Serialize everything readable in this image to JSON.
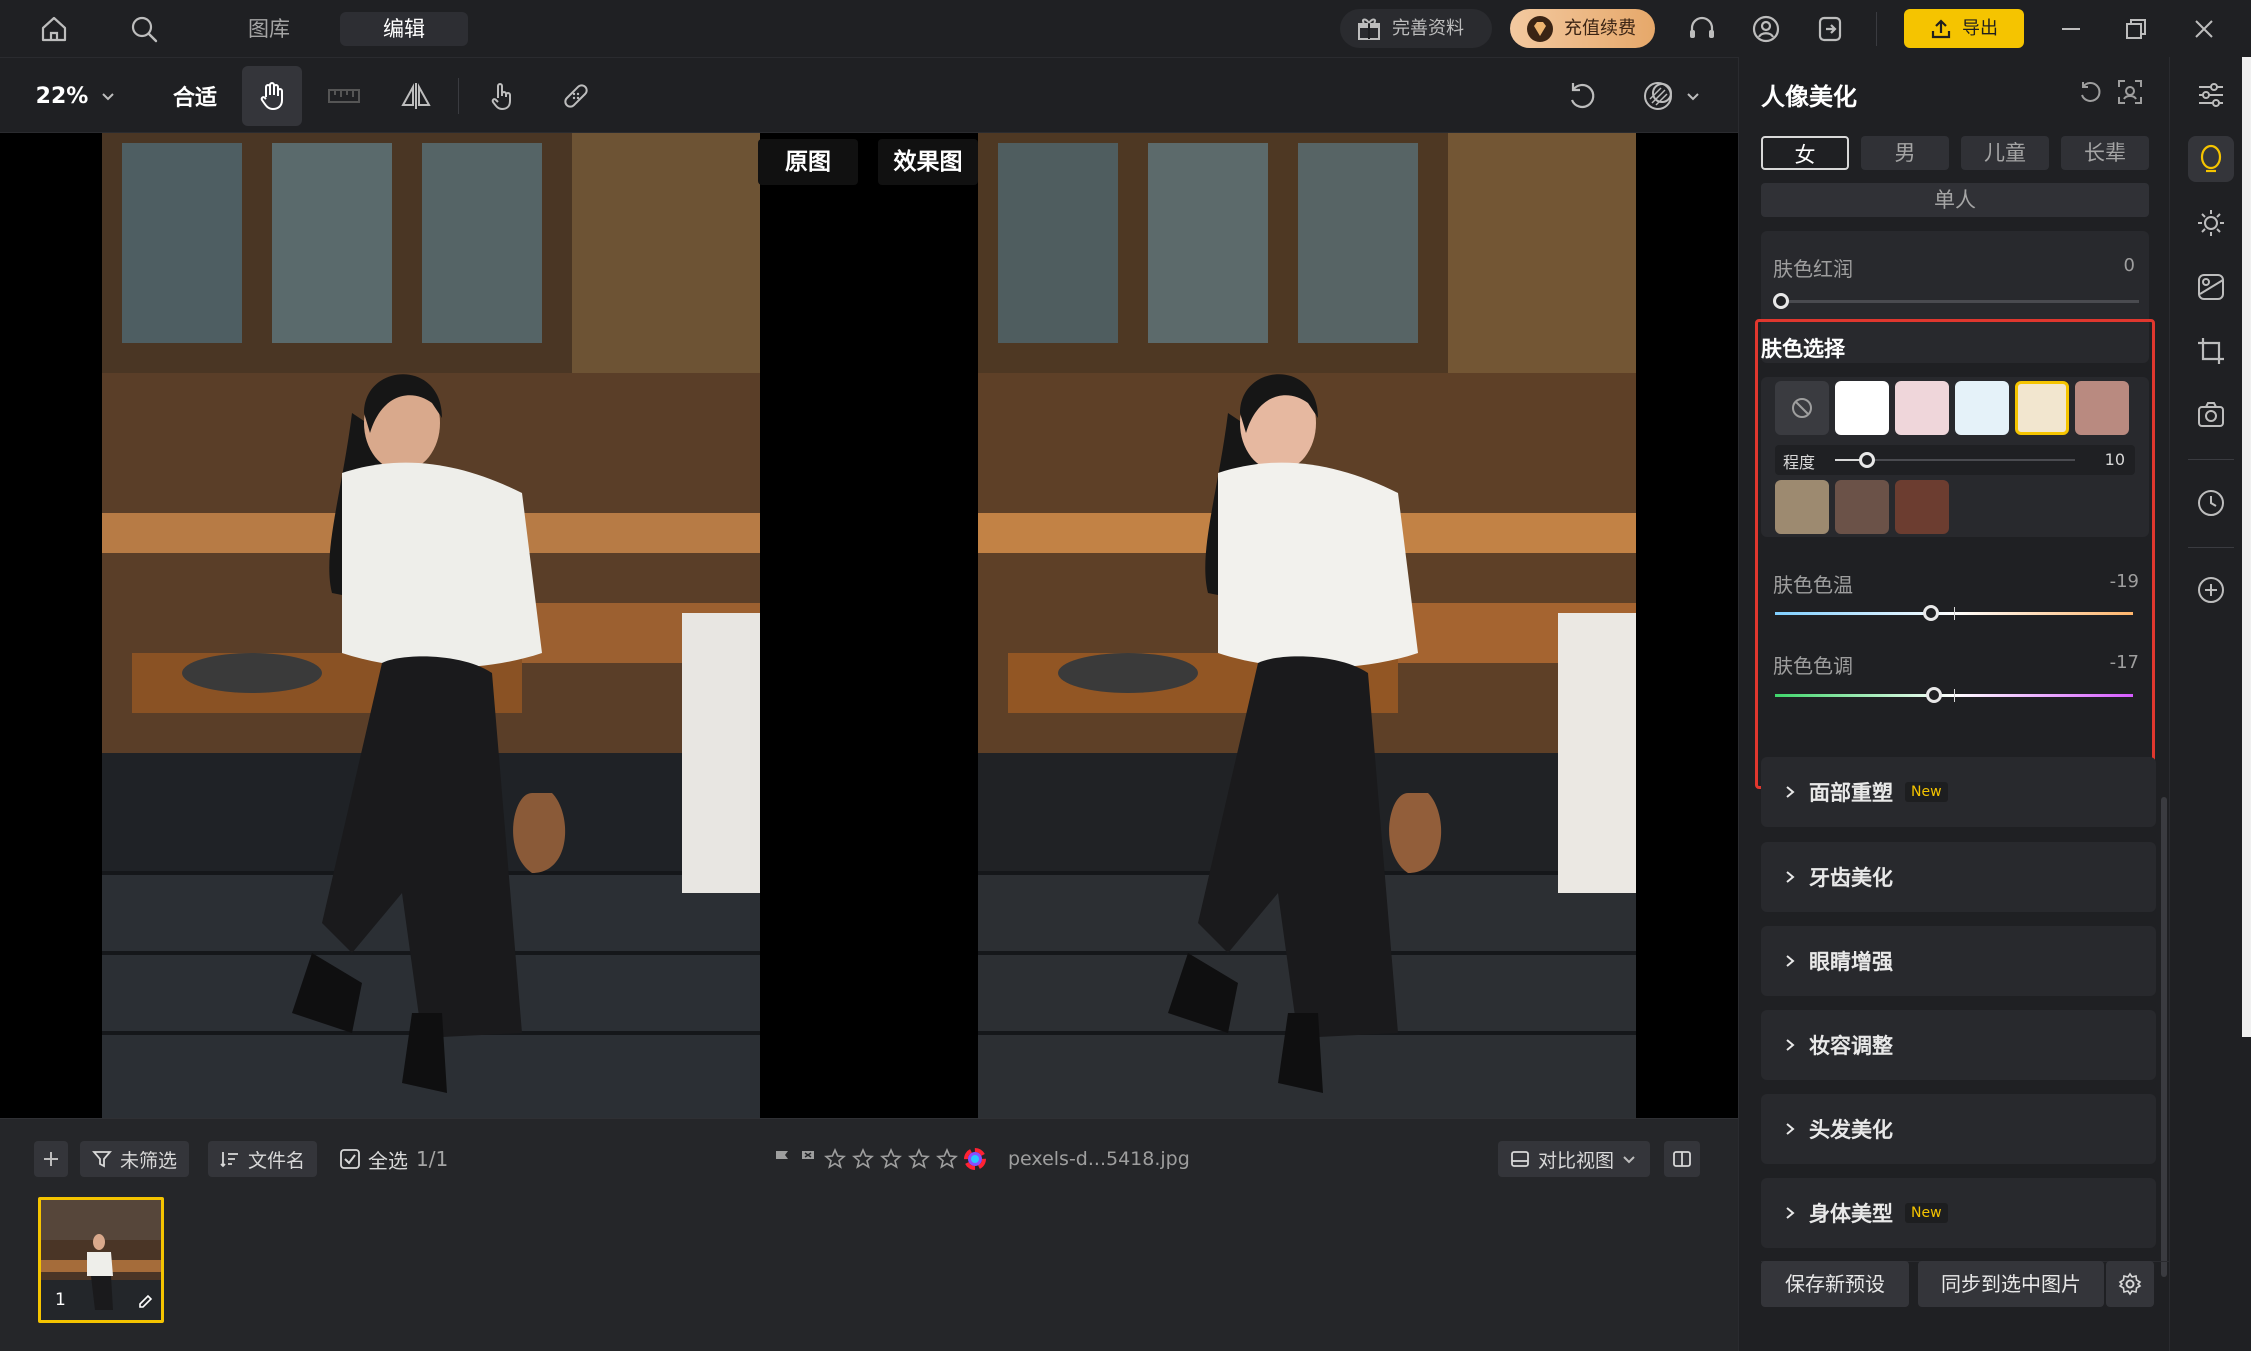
{
  "nav": {
    "tabs": [
      {
        "label": "图库"
      },
      {
        "label": "编辑"
      }
    ]
  },
  "header": {
    "profile_label": "完善资料",
    "recharge_label": "充值续费",
    "export_label": "导出"
  },
  "toolbar": {
    "zoom": "22%",
    "fit_label": "合适"
  },
  "canvas": {
    "original_label": "原图",
    "result_label": "效果图"
  },
  "panel": {
    "title": "人像美化",
    "gender_tabs": [
      {
        "label": "女"
      },
      {
        "label": "男"
      },
      {
        "label": "儿童"
      },
      {
        "label": "长辈"
      }
    ],
    "single_label": "单人",
    "skin_ruddy": {
      "label": "肤色红润",
      "value": "0"
    },
    "skin_select": {
      "title": "肤色选择",
      "swatches_row1": [
        "#ffffff",
        "#efd6da",
        "#e5f2f9",
        "#f2e6cf",
        "#b98a80"
      ],
      "swatches_row2": [
        "#9d8a70",
        "#6b5248",
        "#6c3d30"
      ],
      "degree_label": "程度",
      "degree_value": "10",
      "temp_label": "肤色色温",
      "temp_value": "-19",
      "tone_label": "肤色色调",
      "tone_value": "-17"
    },
    "sections": [
      {
        "label": "面部重塑",
        "badge": "New"
      },
      {
        "label": "牙齿美化",
        "badge": ""
      },
      {
        "label": "眼睛增强",
        "badge": ""
      },
      {
        "label": "妆容调整",
        "badge": ""
      },
      {
        "label": "头发美化",
        "badge": ""
      },
      {
        "label": "身体美型",
        "badge": "New"
      }
    ],
    "save_preset_label": "保存新预设",
    "sync_label": "同步到选中图片"
  },
  "filmstrip": {
    "filter_label": "未筛选",
    "sort_label": "文件名",
    "select_all_label": "全选",
    "count": "1/1",
    "filename": "pexels-d...5418.jpg",
    "view_label": "对比视图",
    "thumb_index": "1"
  },
  "colors": {
    "accent": "#f5c400",
    "highlight_border": "#e0372e",
    "brand_gold": "#e6a86a"
  }
}
